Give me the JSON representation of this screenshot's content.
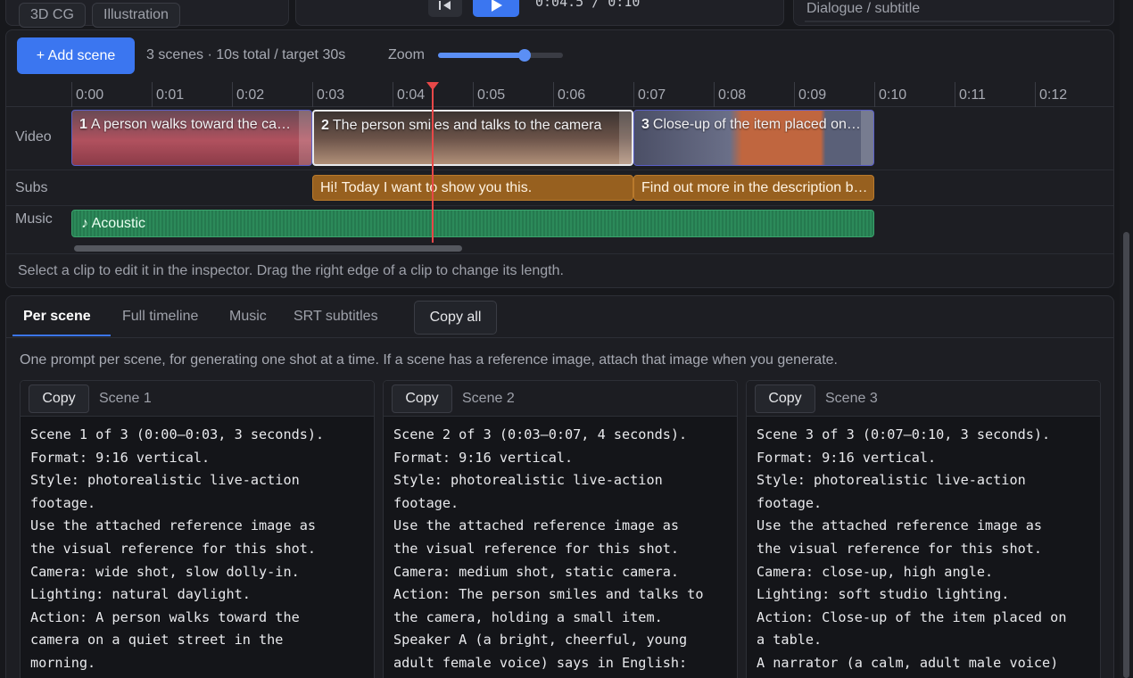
{
  "style_chips": [
    "3D CG",
    "Illustration"
  ],
  "player": {
    "time_readout": "0:04.5 / 0:10",
    "play_icon": "play-icon",
    "prev_icon": "skip-to-start-icon"
  },
  "inspector": {
    "field_label": "Dialogue / subtitle"
  },
  "timeline": {
    "add_scene_label": "+ Add scene",
    "summary": "3 scenes · 10s total / target 30s",
    "zoom_label": "Zoom",
    "zoom_level": 0.69,
    "ticks": [
      "0:00",
      "0:01",
      "0:02",
      "0:03",
      "0:04",
      "0:05",
      "0:06",
      "0:07",
      "0:08",
      "0:09",
      "0:10",
      "0:11",
      "0:12"
    ],
    "playhead_time": 4.5,
    "track_labels": {
      "video": "Video",
      "subs": "Subs",
      "music": "Music"
    },
    "video_clips": [
      {
        "num": "1",
        "title": "A person walks toward the camera on a quiet street",
        "start": 0,
        "end": 3,
        "selected": false
      },
      {
        "num": "2",
        "title": "The person smiles and talks to the camera",
        "start": 3,
        "end": 7,
        "selected": true
      },
      {
        "num": "3",
        "title": "Close-up of the item placed on a table",
        "start": 7,
        "end": 10,
        "selected": false
      }
    ],
    "sub_clips": [
      {
        "text": "Hi! Today I want to show you this.",
        "start": 3,
        "end": 7
      },
      {
        "text": "Find out more in the description below.",
        "start": 7,
        "end": 10
      }
    ],
    "music_clip": {
      "label": "♪ Acoustic",
      "start": 0,
      "end": 10
    },
    "hint": "Select a clip to edit it in the inspector. Drag the right edge of a clip to change its length."
  },
  "prompts": {
    "tabs": [
      "Per scene",
      "Full timeline",
      "Music",
      "SRT subtitles"
    ],
    "active_tab": "Per scene",
    "copy_all_label": "Copy all",
    "description": "One prompt per scene, for generating one shot at a time. If a scene has a reference image, attach that image when you generate.",
    "cards": [
      {
        "copy_label": "Copy",
        "title": "Scene 1",
        "body": "Scene 1 of 3 (0:00–0:03, 3 seconds).\nFormat: 9:16 vertical.\nStyle: photorealistic live-action\nfootage.\nUse the attached reference image as\nthe visual reference for this shot.\nCamera: wide shot, slow dolly-in.\nLighting: natural daylight.\nAction: A person walks toward the\ncamera on a quiet street in the\nmorning."
      },
      {
        "copy_label": "Copy",
        "title": "Scene 2",
        "body": "Scene 2 of 3 (0:03–0:07, 4 seconds).\nFormat: 9:16 vertical.\nStyle: photorealistic live-action\nfootage.\nUse the attached reference image as\nthe visual reference for this shot.\nCamera: medium shot, static camera.\nAction: The person smiles and talks to\nthe camera, holding a small item.\nSpeaker A (a bright, cheerful, young\nadult female voice) says in English:"
      },
      {
        "copy_label": "Copy",
        "title": "Scene 3",
        "body": "Scene 3 of 3 (0:07–0:10, 3 seconds).\nFormat: 9:16 vertical.\nStyle: photorealistic live-action\nfootage.\nUse the attached reference image as\nthe visual reference for this shot.\nCamera: close-up, high angle.\nLighting: soft studio lighting.\nAction: Close-up of the item placed on\na table.\nA narrator (a calm, adult male voice)"
      }
    ]
  },
  "colors": {
    "accent": "#3b76f0",
    "playhead": "#e84848",
    "subtitle_clip": "#97601f",
    "music_clip": "#2c8a5a"
  }
}
